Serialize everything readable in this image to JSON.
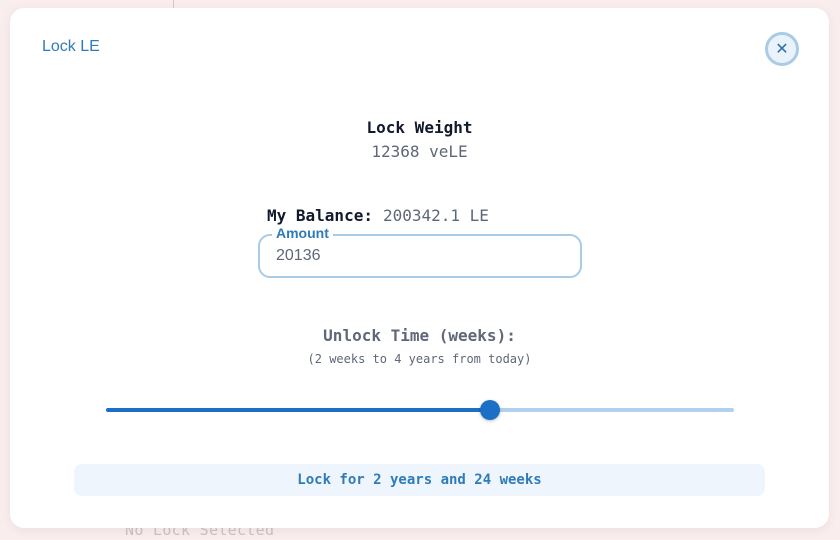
{
  "background": {
    "footer_text": "No Lock Selected"
  },
  "modal": {
    "title": "Lock LE",
    "close_icon": "close-icon"
  },
  "lock_weight": {
    "title": "Lock Weight",
    "value": "12368 veLE"
  },
  "balance": {
    "label": "My Balance:",
    "value": "200342.1 LE"
  },
  "amount_field": {
    "label": "Amount",
    "value": "20136"
  },
  "unlock_time": {
    "title": "Unlock Time (weeks):",
    "subtitle": "(2 weeks to 4 years from today)",
    "slider_fraction": 0.612
  },
  "lock_button": {
    "label": "Lock for 2 years and 24 weeks"
  },
  "colors": {
    "accent": "#2f7bb8",
    "slider_active": "#1c6fc4",
    "slider_inactive": "#b3d1ee",
    "field_border": "#a9cbe6",
    "button_bg": "#eef5fd"
  }
}
